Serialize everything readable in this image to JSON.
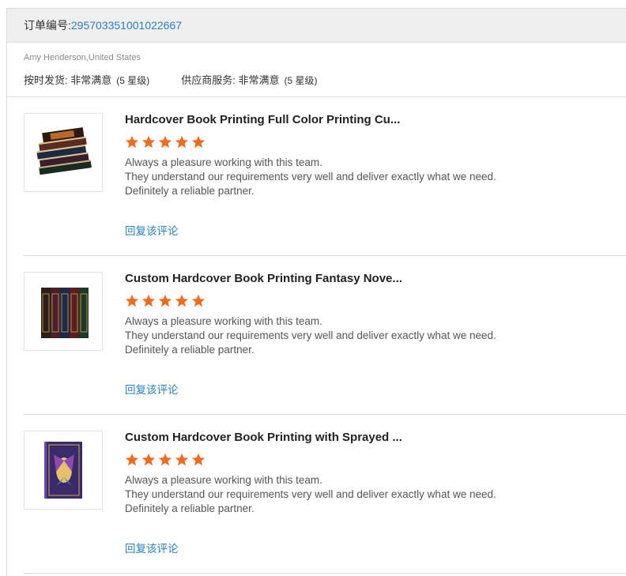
{
  "order": {
    "label": "订单编号:",
    "number": "295703351001022667"
  },
  "buyer": {
    "name": "Amy Henderson,United States"
  },
  "ratings": [
    {
      "label": "按时发货: 非常满意",
      "stars_text": "(5 星级)"
    },
    {
      "label": "供应商服务: 非常满意",
      "stars_text": "(5 星级)"
    }
  ],
  "reviews": [
    {
      "title": "Hardcover Book Printing Full Color Printing Cu...",
      "rating": 5,
      "comment": "Always a pleasure working with this team.\nThey understand our requirements very well and deliver exactly what we need.\nDefinitely a reliable partner.",
      "reply_label": "回复该评论"
    },
    {
      "title": "Custom Hardcover Book Printing Fantasy Nove...",
      "rating": 5,
      "comment": "Always a pleasure working with this team.\nThey understand our requirements very well and deliver exactly what we need.\nDefinitely a reliable partner.",
      "reply_label": "回复该评论"
    },
    {
      "title": "Custom Hardcover Book Printing with Sprayed ...",
      "rating": 5,
      "comment": "Always a pleasure working with this team.\nThey understand our requirements very well and deliver exactly what we need.\nDefinitely a reliable partner.",
      "reply_label": "回复该评论"
    }
  ],
  "colors": {
    "star": "#f26b1d",
    "link": "#2a7fc0"
  }
}
